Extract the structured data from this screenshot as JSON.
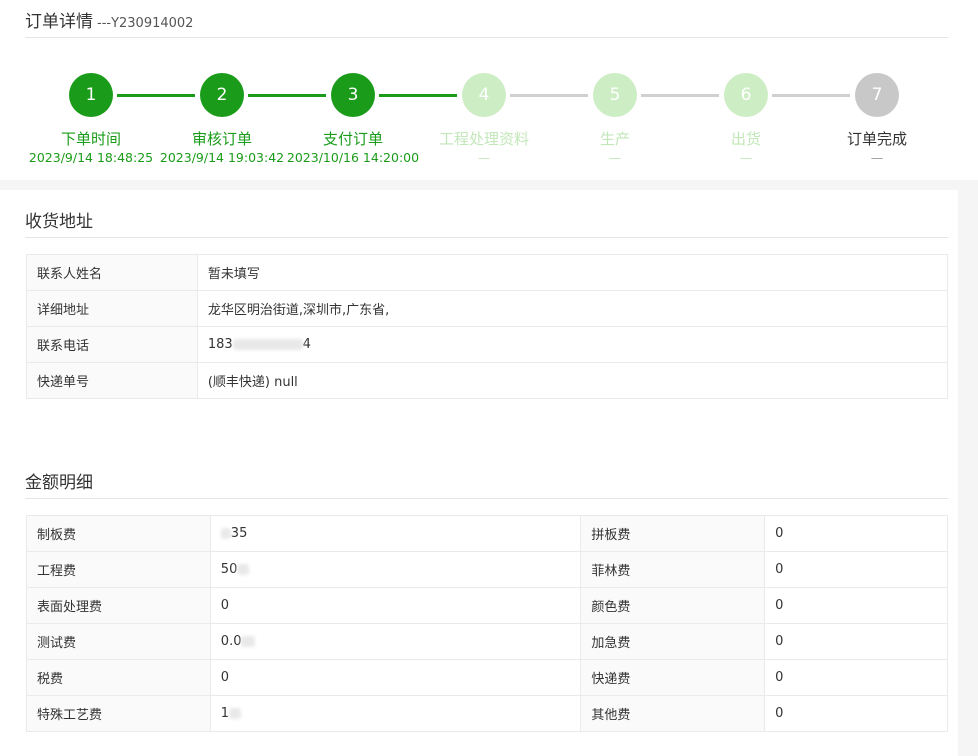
{
  "header": {
    "title": "订单详情",
    "order_no": "---Y230914002"
  },
  "steps": [
    {
      "num": "1",
      "label": "下单时间",
      "time": "2023/9/14 18:48:25",
      "state": "done"
    },
    {
      "num": "2",
      "label": "审核订单",
      "time": "2023/9/14 19:03:42",
      "state": "done"
    },
    {
      "num": "3",
      "label": "支付订单",
      "time": "2023/10/16 14:20:00",
      "state": "done"
    },
    {
      "num": "4",
      "label": "工程处理资料",
      "time": "—",
      "state": "pending"
    },
    {
      "num": "5",
      "label": "生产",
      "time": "—",
      "state": "pending"
    },
    {
      "num": "6",
      "label": "出货",
      "time": "—",
      "state": "pending"
    },
    {
      "num": "7",
      "label": "订单完成",
      "time": "—",
      "state": "final"
    }
  ],
  "address": {
    "title": "收货地址",
    "rows": [
      {
        "key": "联系人姓名",
        "value": "暂未填写"
      },
      {
        "key": "详细地址",
        "value": "龙华区明治街道,深圳市,广东省,"
      },
      {
        "key": "联系电话",
        "value": "183",
        "value_tail": "4"
      },
      {
        "key": "快递单号",
        "value": "(顺丰快递) null"
      }
    ]
  },
  "fees": {
    "title": "金额明细",
    "rows": [
      {
        "k1": "制板费",
        "v1": "35",
        "k2": "拼板费",
        "v2": "0"
      },
      {
        "k1": "工程费",
        "v1": "50",
        "k2": "菲林费",
        "v2": "0"
      },
      {
        "k1": "表面处理费",
        "v1": "0",
        "k2": "颜色费",
        "v2": "0"
      },
      {
        "k1": "测试费",
        "v1": "0.0",
        "k2": "加急费",
        "v2": "0"
      },
      {
        "k1": "税费",
        "v1": "0",
        "k2": "快递费",
        "v2": "0"
      },
      {
        "k1": "特殊工艺费",
        "v1": "1",
        "k2": "其他费",
        "v2": "0"
      }
    ]
  },
  "colors": {
    "done": "#1a9c1a",
    "pending": "#cdeec4",
    "final": "#c8c8c8"
  }
}
